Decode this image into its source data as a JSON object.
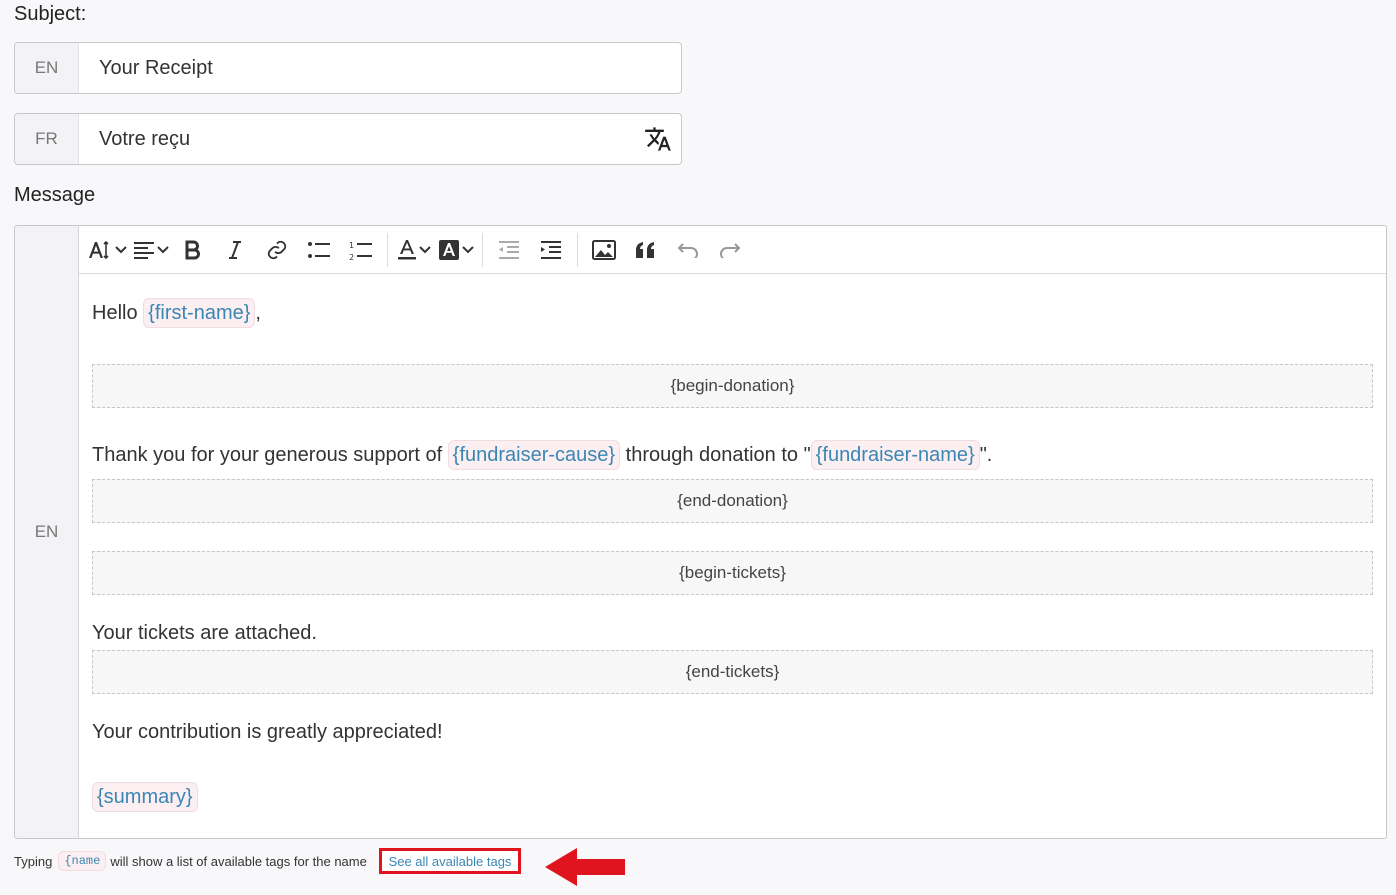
{
  "subject": {
    "label": "Subject:",
    "entries": [
      {
        "lang": "EN",
        "value": "Your Receipt"
      },
      {
        "lang": "FR",
        "value": "Votre reçu"
      }
    ]
  },
  "message": {
    "label": "Message",
    "lang": "EN",
    "toolbar": [
      "font-size-icon",
      "align-icon",
      "bold-icon",
      "italic-icon",
      "link-icon",
      "bulleted-list-icon",
      "numbered-list-icon",
      "font-color-icon",
      "highlight-icon",
      "outdent-icon",
      "indent-icon",
      "image-icon",
      "quote-icon",
      "undo-icon",
      "redo-icon"
    ],
    "content": {
      "hello": "Hello",
      "first_name_tag": "{first-name}",
      "comma": ",",
      "begin_donation": "{begin-donation}",
      "thanks_text": "Thank you for your generous support of",
      "cause_tag": "{fundraiser-cause}",
      "through_text": "through donation to \"",
      "fundraiser_name_tag": "{fundraiser-name}",
      "closing_quote": "\".",
      "end_donation": "{end-donation}",
      "begin_tickets": "{begin-tickets}",
      "tickets_text": "Your tickets are attached.",
      "end_tickets": "{end-tickets}",
      "appreciation": "Your contribution is greatly appreciated!",
      "summary_tag": "{summary}"
    }
  },
  "hint": {
    "prefix": "Typing",
    "code": "{name",
    "suffix": "will show a list of available tags for the name",
    "link": "See all available tags"
  },
  "colors": {
    "accent": "#3a86b4",
    "tag_bg": "#fbeff1",
    "highlight": "#e0141f"
  }
}
